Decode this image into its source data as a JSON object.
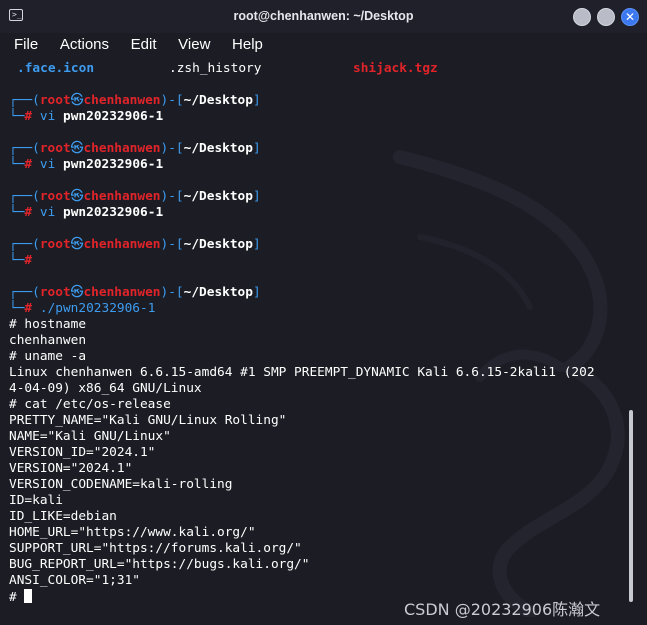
{
  "window": {
    "title": "root@chenhanwen: ~/Desktop"
  },
  "menu": [
    "File",
    "Actions",
    "Edit",
    "View",
    "Help"
  ],
  "files": [
    ".face.icon",
    ".zsh_history",
    "shijack.tgz"
  ],
  "prompt": {
    "open": "┌──(",
    "user": "root",
    "at": "㉿",
    "host": "chenhanwen",
    "mid": ")-[",
    "path": "~/Desktop",
    "close": "]",
    "corner": "└─",
    "hash": "#"
  },
  "commands": [
    {
      "cmd": "vi",
      "arg": "pwn20232906-1"
    },
    {
      "cmd": "vi",
      "arg": "pwn20232906-1"
    },
    {
      "cmd": "vi",
      "arg": "pwn20232906-1"
    },
    {
      "cmd": "",
      "arg": ""
    },
    {
      "cmd": "./pwn20232906-1",
      "arg": ""
    }
  ],
  "output": [
    "# hostname",
    "chenhanwen",
    "# uname -a",
    "Linux chenhanwen 6.6.15-amd64 #1 SMP PREEMPT_DYNAMIC Kali 6.6.15-2kali1 (202",
    "4-04-09) x86_64 GNU/Linux",
    "# cat /etc/os-release",
    "PRETTY_NAME=\"Kali GNU/Linux Rolling\"",
    "NAME=\"Kali GNU/Linux\"",
    "VERSION_ID=\"2024.1\"",
    "VERSION=\"2024.1\"",
    "VERSION_CODENAME=kali-rolling",
    "ID=kali",
    "ID_LIKE=debian",
    "HOME_URL=\"https://www.kali.org/\"",
    "SUPPORT_URL=\"https://forums.kali.org/\"",
    "BUG_REPORT_URL=\"https://bugs.kali.org/\"",
    "ANSI_COLOR=\"1;31\""
  ],
  "final_prompt": "# ",
  "watermark": "CSDN @20232906陈瀚文",
  "colors": {
    "background": "#1b1c24",
    "accent_blue": "#3d9cf0",
    "accent_red": "#e0242a",
    "close_button": "#3c79f0"
  }
}
